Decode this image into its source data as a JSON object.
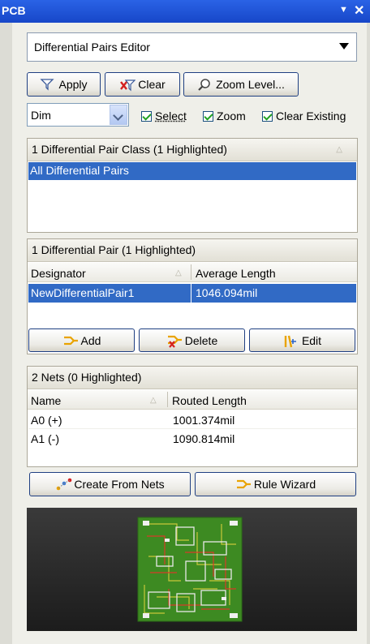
{
  "window": {
    "title": "PCB"
  },
  "mode_combo": {
    "value": "Differential Pairs Editor"
  },
  "toolbar": {
    "apply": "Apply",
    "clear": "Clear",
    "zoom": "Zoom Level..."
  },
  "mask": {
    "value": "Dim",
    "select": "Select",
    "zoom": "Zoom",
    "clear_existing": "Clear Existing"
  },
  "classes_panel": {
    "header": "1 Differential Pair Class (1 Highlighted)",
    "items": [
      "All Differential Pairs"
    ]
  },
  "pairs_panel": {
    "header": "1 Differential Pair (1 Highlighted)",
    "columns": [
      "Designator",
      "Average Length"
    ],
    "rows": [
      {
        "designator": "NewDifferentialPair1",
        "length": "1046.094mil"
      }
    ],
    "add": "Add",
    "delete": "Delete",
    "edit": "Edit"
  },
  "nets_panel": {
    "header": "2 Nets (0 Highlighted)",
    "columns": [
      "Name",
      "Routed Length"
    ],
    "rows": [
      {
        "name": "A0 (+)",
        "length": "1001.374mil"
      },
      {
        "name": "A1 (-)",
        "length": "1090.814mil"
      }
    ],
    "create_from_nets": "Create From Nets",
    "rule_wizard": "Rule Wizard"
  },
  "colors": {
    "title_bar": "#1f55d8",
    "selection": "#316ac5",
    "pcb_green": "#3d8a22"
  }
}
